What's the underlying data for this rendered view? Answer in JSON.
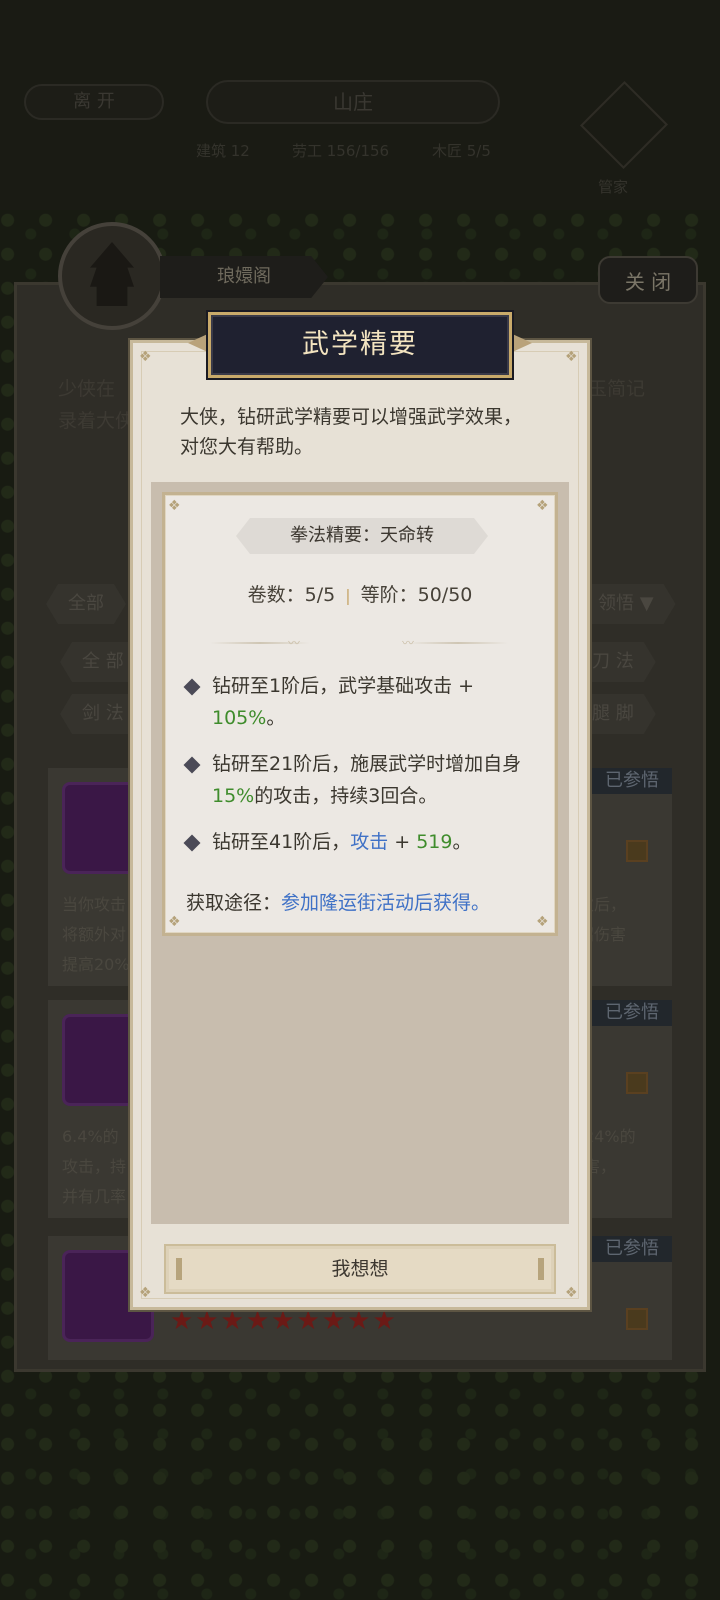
{
  "top_bar": {
    "leave_label": "离 开",
    "title": "山庄",
    "stats": [
      "建筑 12",
      "劳工 156/156",
      "木匠 5/5"
    ],
    "manager_label": "管家"
  },
  "panel": {
    "tab_label": "琅嬛阁",
    "close_label": "关 闭",
    "desc_left": "少侠在",
    "desc_left2": "录着大侠",
    "desc_right": "玉简记",
    "filter_all": "全部",
    "filter_sort": "领悟",
    "cat_all": "全 部",
    "cat_sword": "剑 法",
    "cat_blade": "刀 法",
    "cat_leg": "腿 脚",
    "cards": [
      {
        "badge": "已参悟",
        "desc_lines": [
          "当你攻击",
          "将额外对",
          "提高20%"
        ],
        "desc_right": [
          "次后，",
          "招伤害"
        ]
      },
      {
        "badge": "已参悟",
        "desc_lines": [
          "6.4%的",
          "攻击，持",
          "并有几率"
        ],
        "desc_right": [
          "得24%的",
          "伤害，"
        ]
      },
      {
        "badge": "已参悟",
        "desc_lines": [],
        "desc_right": []
      }
    ],
    "stars": "★★★★★★★★★"
  },
  "modal": {
    "title": "武学精要",
    "intro": "大侠，钻研武学精要可以增强武学效果，对您大有帮助。",
    "name": "拳法精要：天命转",
    "volumes_label": "卷数：5/5",
    "level_label": "等阶：50/50",
    "effects": [
      {
        "prefix": "钻研至1阶后，武学基础攻击 + ",
        "highlight": "105%",
        "suffix": "。"
      },
      {
        "prefix": "钻研至21阶后，施展武学时增加自身",
        "highlight": "15%",
        "suffix": "的攻击，持续3回合。"
      },
      {
        "prefix": "钻研至41阶后，",
        "stat": "攻击",
        "plus": " + ",
        "highlight": "519",
        "suffix": "。"
      }
    ],
    "source_label": "获取途径：",
    "source_value": "参加隆运街活动后获得。",
    "button_label": "我想想"
  },
  "colors": {
    "highlight_green": "#3f8c2c",
    "highlight_blue": "#3f71c6",
    "title_plate_bg": "#1f2130",
    "title_text": "#f3e4c0"
  }
}
